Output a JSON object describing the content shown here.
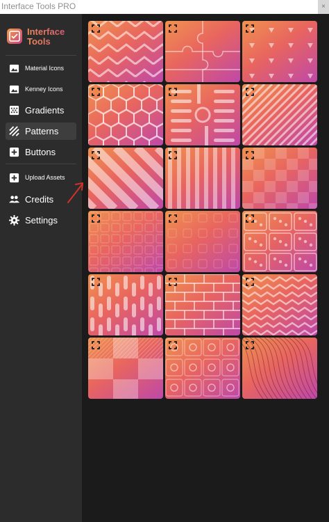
{
  "window": {
    "title": "Interface Tools PRO",
    "close_glyph": "×"
  },
  "app": {
    "name": "Interface Tools",
    "logo_icon": "checklist-icon",
    "accent_from": "#f2a04a",
    "accent_to": "#c8407e"
  },
  "sidebar": {
    "items": [
      {
        "label": "Material Icons",
        "icon": "image-icon",
        "active": false
      },
      {
        "label": "Kenney Icons",
        "icon": "image-icon",
        "active": false
      },
      {
        "label": "Gradients",
        "icon": "gradient-icon",
        "active": false
      },
      {
        "label": "Patterns",
        "icon": "stripes-icon",
        "active": true
      },
      {
        "label": "Buttons",
        "icon": "add-box-icon",
        "active": false
      },
      {
        "label": "Upload Assets",
        "icon": "add-box-icon",
        "active": false
      },
      {
        "label": "Credits",
        "icon": "people-icon",
        "active": false
      },
      {
        "label": "Settings",
        "icon": "gear-icon",
        "active": false
      }
    ]
  },
  "patterns": [
    {
      "name": "chevron-pattern"
    },
    {
      "name": "puzzle-pattern"
    },
    {
      "name": "triangles-pattern"
    },
    {
      "name": "hexagon-pattern"
    },
    {
      "name": "circuit-pattern"
    },
    {
      "name": "thin-diagonal-stripes-pattern"
    },
    {
      "name": "wide-diagonal-stripes-pattern"
    },
    {
      "name": "vertical-stripes-pattern"
    },
    {
      "name": "checkerboard-pattern"
    },
    {
      "name": "squares-grid-pattern"
    },
    {
      "name": "faint-icons-pattern"
    },
    {
      "name": "dominoes-pattern"
    },
    {
      "name": "pills-pattern"
    },
    {
      "name": "bricks-pattern"
    },
    {
      "name": "zigzag-pattern"
    },
    {
      "name": "hatched-checker-pattern"
    },
    {
      "name": "studs-pattern"
    },
    {
      "name": "topography-pattern"
    }
  ],
  "colors": {
    "sidebar_bg": "#2c2c2c",
    "content_bg": "#1b1b1b",
    "tile_from": "#f0924f",
    "tile_mid": "#e8655f",
    "tile_to": "#bf48a8",
    "annotation_arrow": "#d0312d"
  }
}
